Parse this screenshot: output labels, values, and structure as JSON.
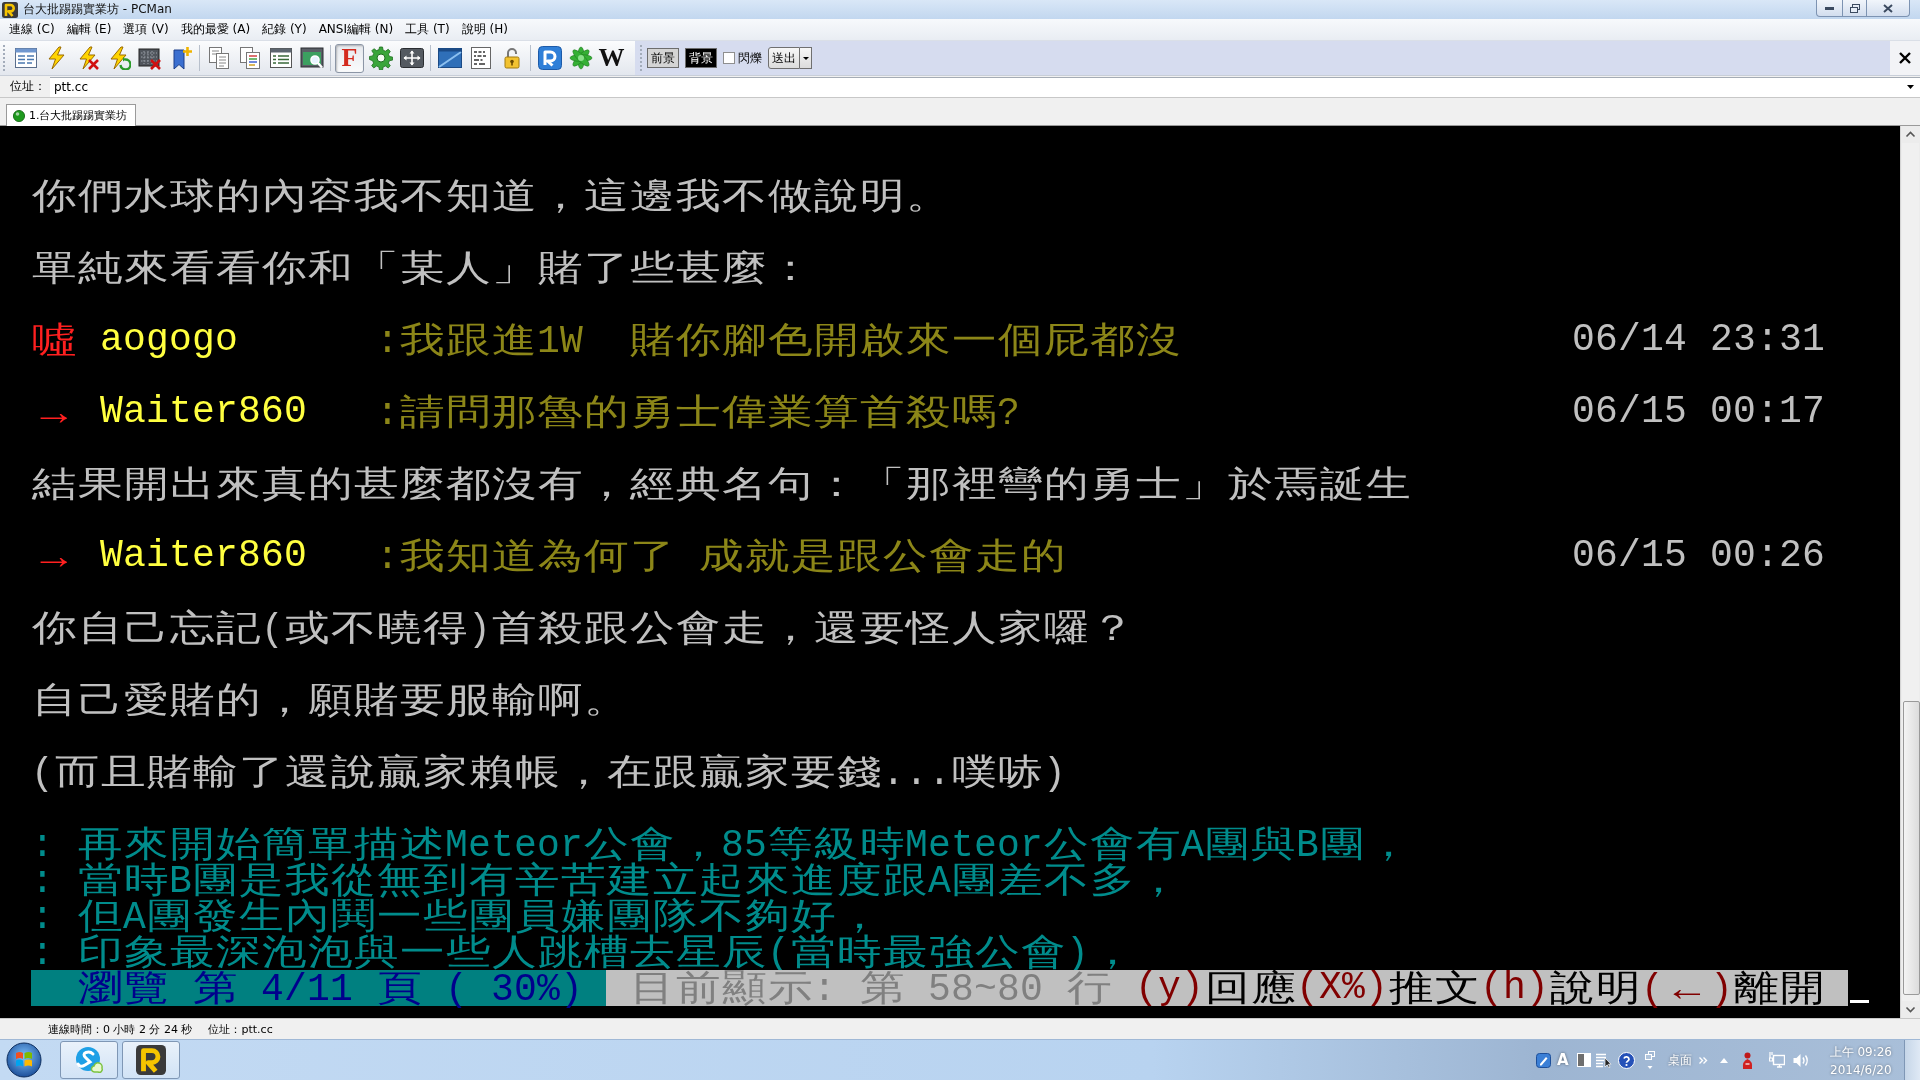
{
  "window": {
    "title": "台大批踢踢實業坊 - PCMan"
  },
  "menu": [
    "連線 (C)",
    "編輯 (E)",
    "選項 (V)",
    "我的最愛 (A)",
    "紀錄 (Y)",
    "ANSI編輯 (N)",
    "工具 (T)",
    "說明 (H)"
  ],
  "toolbar": {
    "letter_buttons": [
      {
        "label": "F",
        "pressed": true
      },
      {
        "label": "W",
        "pressed": false
      }
    ],
    "foreground": "前景",
    "background": "背景",
    "blink": {
      "label": "閃爍",
      "checked": false
    },
    "send": "送出"
  },
  "address": {
    "label": "位址：",
    "value": "ptt.cc"
  },
  "tabs": [
    {
      "label": "1.台大批踢踢實業坊",
      "selected": true,
      "connected": true
    }
  ],
  "terminal": {
    "lines": [
      {
        "kind": "text",
        "text": "你們水球的內容我不知道，這邊我不做說明。"
      },
      {
        "kind": "text",
        "text": "單純來看看你和「某人」賭了些甚麼："
      },
      {
        "kind": "push",
        "tag": "噓",
        "user": "aogogo",
        "content": ":我跟進1W  賭你腳色開啟來一個屁都沒",
        "time": "06/14 23:31"
      },
      {
        "kind": "push",
        "tag": "→",
        "user": "Waiter860",
        "content": ":請問那魯的勇士偉業算首殺嗎?",
        "time": "06/15 00:17"
      },
      {
        "kind": "text",
        "text": "結果開出來真的甚麼都沒有，經典名句：「那裡彎的勇士」於焉誕生"
      },
      {
        "kind": "push",
        "tag": "→",
        "user": "Waiter860",
        "content": ":我知道為何了 成就是跟公會走的",
        "time": "06/15 00:26"
      },
      {
        "kind": "text",
        "text": "你自己忘記(或不曉得)首殺跟公會走，還要怪人家囉？"
      },
      {
        "kind": "text",
        "text": "自己愛賭的，願賭要服輸啊。"
      },
      {
        "kind": "text",
        "text": "(而且賭輸了還說贏家賴帳，在跟贏家要錢...噗哧)"
      },
      {
        "kind": "quote",
        "text": ": 再來開始簡單描述Meteor公會，85等級時Meteor公會有A團與B團，"
      },
      {
        "kind": "quote",
        "text": ": 當時B團是我從無到有辛苦建立起來進度跟A團差不多，"
      },
      {
        "kind": "quote",
        "text": ": 但A團發生內鬨一些團員嫌團隊不夠好，"
      },
      {
        "kind": "quote",
        "text": ": 印象最深泡泡與一些人跳槽去星辰(當時最強公會)，"
      }
    ],
    "pager": {
      "position": "瀏覽 第 4/11 頁 ( 30%)",
      "range": "目前顯示: 第 58~80 行",
      "keys": [
        {
          "key": "(y)",
          "action": "回應"
        },
        {
          "key": "(X%)",
          "action": "推文"
        },
        {
          "key": "(h)",
          "action": "說明"
        },
        {
          "key": "(←)",
          "action": "離開"
        }
      ]
    }
  },
  "status_bar": {
    "connection_time": "連線時間：0 小時 2 分 24 秒",
    "address": "位址：ptt.cc"
  },
  "taskbar": {
    "language_mode": "A",
    "toolbar_label": "桌面",
    "time": "上午 09:26",
    "date": "2014/6/20"
  }
}
